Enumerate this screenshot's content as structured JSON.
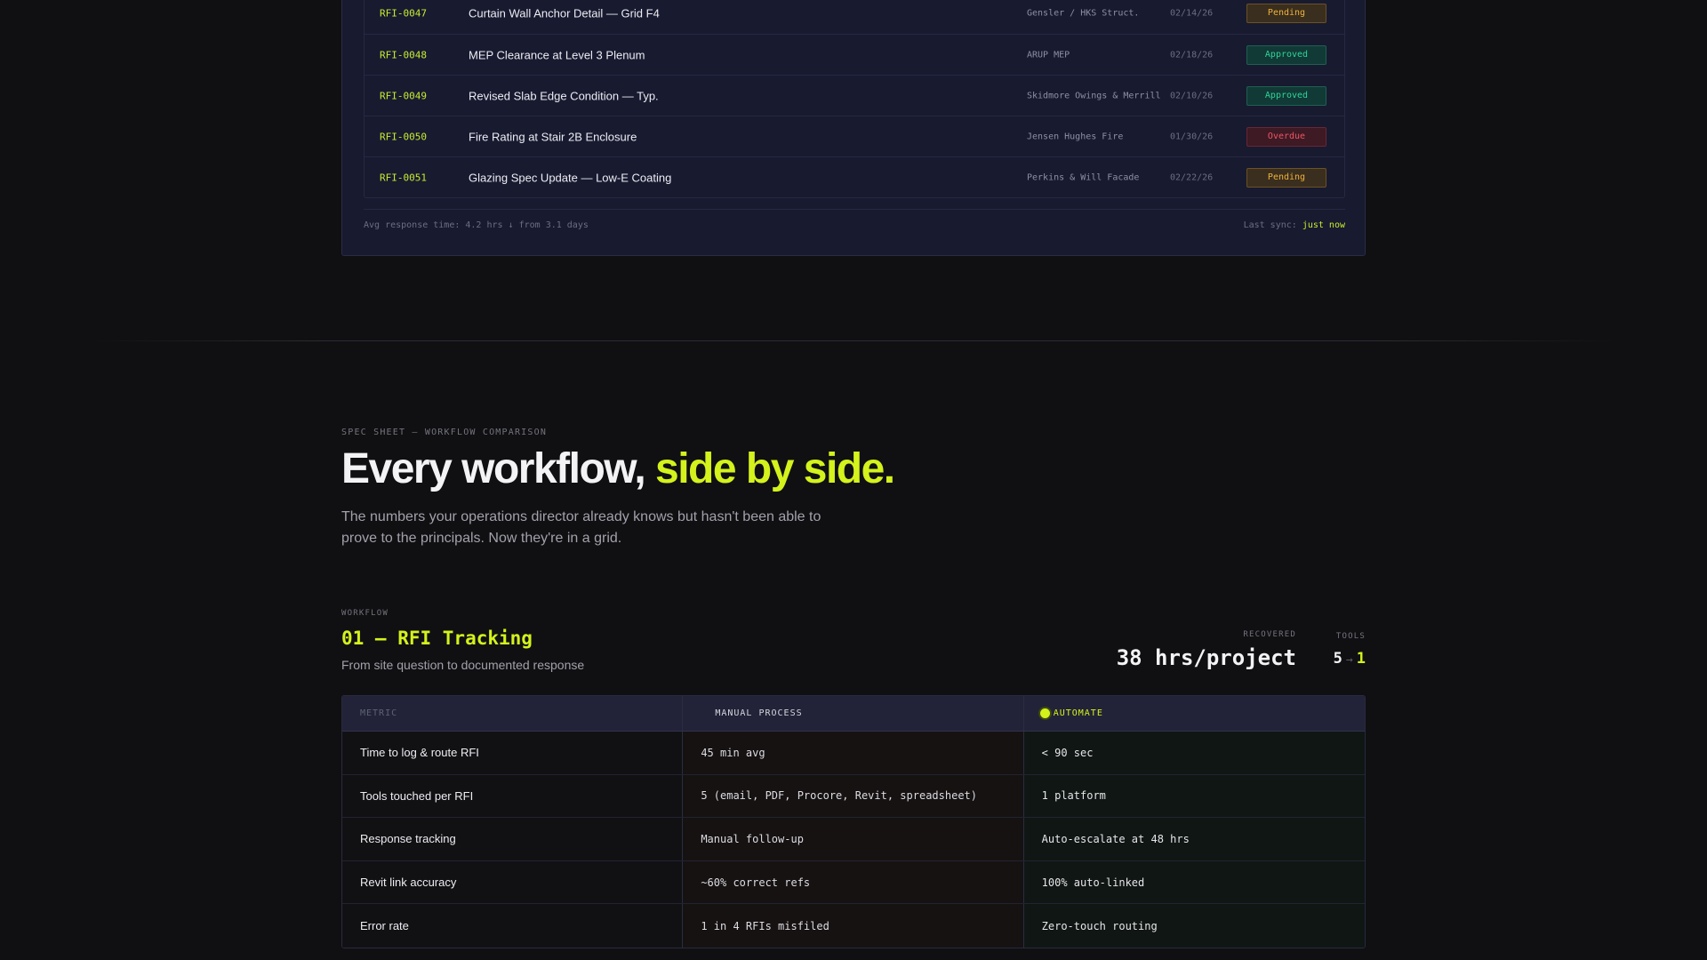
{
  "rfi_panel": {
    "rows": [
      {
        "id": "RFI-0047",
        "title": "Curtain Wall Anchor Detail — Grid F4",
        "firm": "Gensler / HKS Struct.",
        "date": "02/14/26",
        "status": "Pending"
      },
      {
        "id": "RFI-0048",
        "title": "MEP Clearance at Level 3 Plenum",
        "firm": "ARUP MEP",
        "date": "02/18/26",
        "status": "Approved"
      },
      {
        "id": "RFI-0049",
        "title": "Revised Slab Edge Condition — Typ.",
        "firm": "Skidmore Owings & Merrill",
        "date": "02/10/26",
        "status": "Approved"
      },
      {
        "id": "RFI-0050",
        "title": "Fire Rating at Stair 2B Enclosure",
        "firm": "Jensen Hughes Fire",
        "date": "01/30/26",
        "status": "Overdue"
      },
      {
        "id": "RFI-0051",
        "title": "Glazing Spec Update — Low-E Coating",
        "firm": "Perkins & Will Facade",
        "date": "02/22/26",
        "status": "Pending"
      }
    ],
    "footer": {
      "avg_response": "Avg response time: 4.2 hrs ↓ from 3.1 days",
      "sync_label": "Last sync:",
      "sync_value": "just now"
    },
    "status_colors": {
      "Pending": "#f0b23a",
      "Approved": "#2fd49a",
      "Overdue": "#f05466"
    }
  },
  "spec": {
    "eyebrow": "SPEC SHEET — WORKFLOW COMPARISON",
    "headline_main": "Every workflow, ",
    "headline_accent": "side by side.",
    "subtext": "The numbers your operations director already knows but hasn't been able to prove to the principals. Now they're in a grid."
  },
  "workflow": {
    "eyebrow": "WORKFLOW",
    "title": "01 — RFI Tracking",
    "subtitle": "From site question to documented response",
    "recovered_label": "RECOVERED",
    "recovered_value": "38 hrs/project",
    "tools_label": "TOOLS",
    "tools_before": "5",
    "tools_arrow": "→",
    "tools_after": "1"
  },
  "table": {
    "headers": {
      "metric": "METRIC",
      "manual": "MANUAL PROCESS",
      "automate": "AUTOMATE"
    },
    "rows": [
      {
        "metric": "Time to log & route RFI",
        "manual": "45 min avg",
        "automate": "< 90 sec"
      },
      {
        "metric": "Tools touched per RFI",
        "manual": "5 (email, PDF, Procore, Revit, spreadsheet)",
        "automate": "1 platform"
      },
      {
        "metric": "Response tracking",
        "manual": "Manual follow-up",
        "automate": "Auto-escalate at 48 hrs"
      },
      {
        "metric": "Revit link accuracy",
        "manual": "~60% correct refs",
        "automate": "100% auto-linked"
      },
      {
        "metric": "Error rate",
        "manual": "1 in 4 RFIs misfiled",
        "automate": "Zero-touch routing"
      }
    ]
  },
  "accent_color": "#d4f21c"
}
